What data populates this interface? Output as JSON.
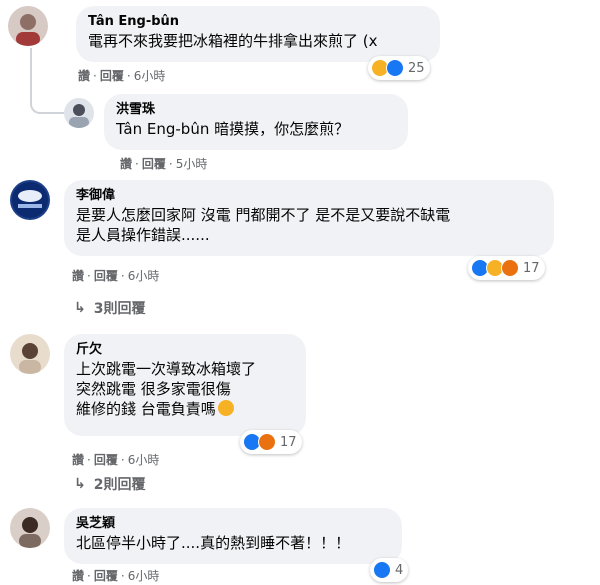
{
  "comments": [
    {
      "author": "Tân Eng-bûn",
      "lines": [
        "電再不來我要把冰箱裡的牛排拿出來煎了 (x"
      ],
      "actions": {
        "like": "讚",
        "reply": "回覆",
        "time": "6小時"
      },
      "reactions": {
        "icons": [
          "haha-icon",
          "like-icon"
        ],
        "count": "25"
      }
    },
    {
      "author": "洪雪珠",
      "lines": [
        "Tân Eng-bûn 暗摸摸，你怎麼煎？"
      ],
      "mention": "Tân Eng-bûn",
      "actions": {
        "like": "讚",
        "reply": "回覆",
        "time": "5小時"
      }
    },
    {
      "author": "李御偉",
      "lines": [
        "是要人怎麼回家阿 沒電 門都開不了 是不是又要說不缺電",
        "是人員操作錯誤......"
      ],
      "actions": {
        "like": "讚",
        "reply": "回覆",
        "time": "6小時"
      },
      "reactions": {
        "icons": [
          "like-icon",
          "haha-icon",
          "angry-icon"
        ],
        "count": "17"
      },
      "replies": "3則回覆"
    },
    {
      "author": "斤欠",
      "lines": [
        "上次跳電一次導致冰箱壞了",
        "突然跳電 很多家電很傷",
        "維修的錢 台電負責嗎"
      ],
      "actions": {
        "like": "讚",
        "reply": "回覆",
        "time": "6小時"
      },
      "reactions": {
        "icons": [
          "like-icon",
          "angry-icon"
        ],
        "count": "17"
      },
      "replies": "2則回覆"
    },
    {
      "author": "吳芝穎",
      "lines": [
        "北區停半小時了....真的熱到睡不著！！！"
      ],
      "actions": {
        "like": "讚",
        "reply": "回覆",
        "time": "6小時"
      },
      "reactions": {
        "icons": [
          "like-icon"
        ],
        "count": "4"
      }
    }
  ],
  "colors": {
    "bubble": "#f0f2f5",
    "meta": "#65676b",
    "like": "#1877f2",
    "haha": "#f7b125",
    "angry": "#e9710f"
  }
}
